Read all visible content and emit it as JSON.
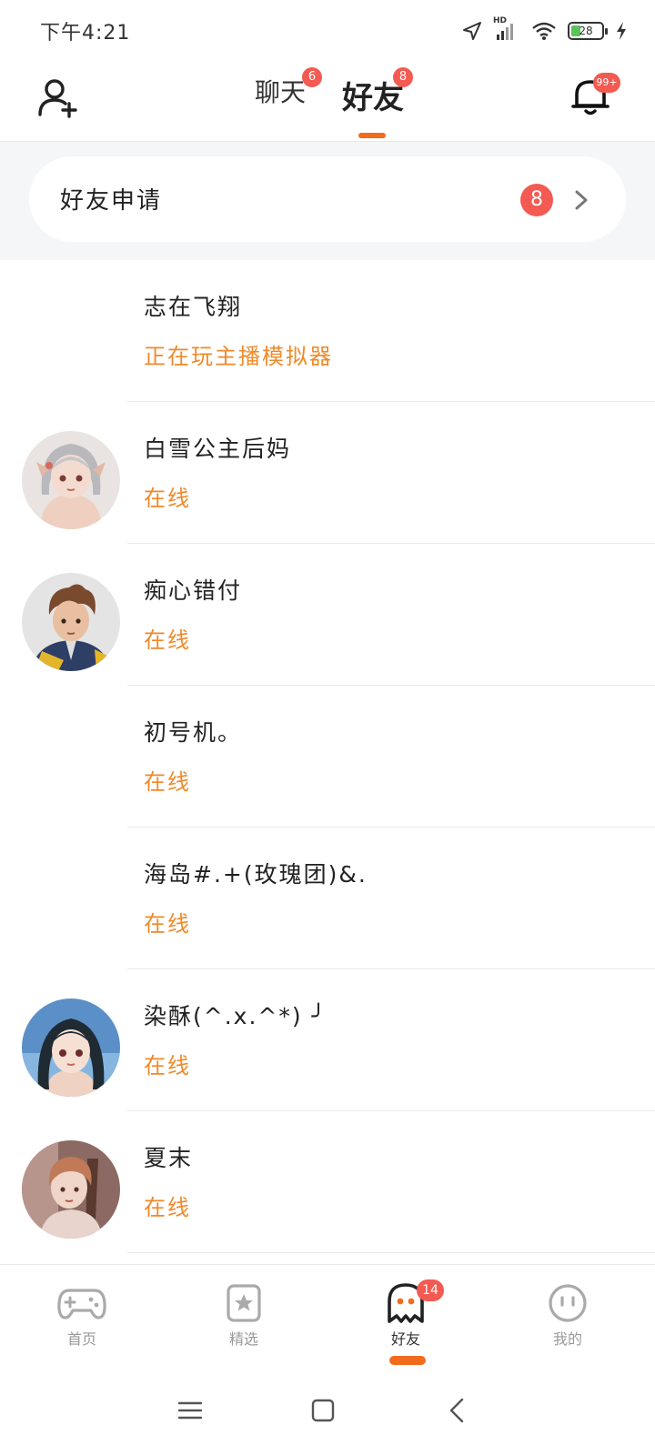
{
  "status_bar": {
    "time": "下午4:21",
    "network_label": "HD",
    "battery": "28"
  },
  "header": {
    "tabs": [
      {
        "label": "聊天",
        "badge": "6",
        "active": false
      },
      {
        "label": "好友",
        "badge": "8",
        "active": true
      }
    ],
    "notification_badge": "99+",
    "icons": {
      "add_friend": "add-user-icon",
      "notifications": "bell-icon"
    }
  },
  "friend_requests": {
    "label": "好友申请",
    "count": "8"
  },
  "friends": [
    {
      "name": "志在飞翔",
      "status": "正在玩主播模拟器",
      "has_avatar": false
    },
    {
      "name": "白雪公主后妈",
      "status": "在线",
      "has_avatar": true
    },
    {
      "name": "痴心错付",
      "status": "在线",
      "has_avatar": true
    },
    {
      "name": "初号机。",
      "status": "在线",
      "has_avatar": false
    },
    {
      "name": "海岛#.+(玫瑰团)&.",
      "status": "在线",
      "has_avatar": false
    },
    {
      "name": "染酥(^.x.^*) ╯",
      "status": "在线",
      "has_avatar": true
    },
    {
      "name": "夏末",
      "status": "在线",
      "has_avatar": true
    }
  ],
  "bottom_nav": [
    {
      "label": "首页",
      "icon": "gamepad-icon",
      "active": false
    },
    {
      "label": "精选",
      "icon": "star-card-icon",
      "active": false
    },
    {
      "label": "好友",
      "icon": "ghost-icon",
      "active": true,
      "badge": "14"
    },
    {
      "label": "我的",
      "icon": "face-icon",
      "active": false
    }
  ],
  "colors": {
    "accent": "#f26b1d",
    "badge": "#f35a52",
    "status_text": "#ef8a2a",
    "request_background": "#f5f6f8"
  }
}
